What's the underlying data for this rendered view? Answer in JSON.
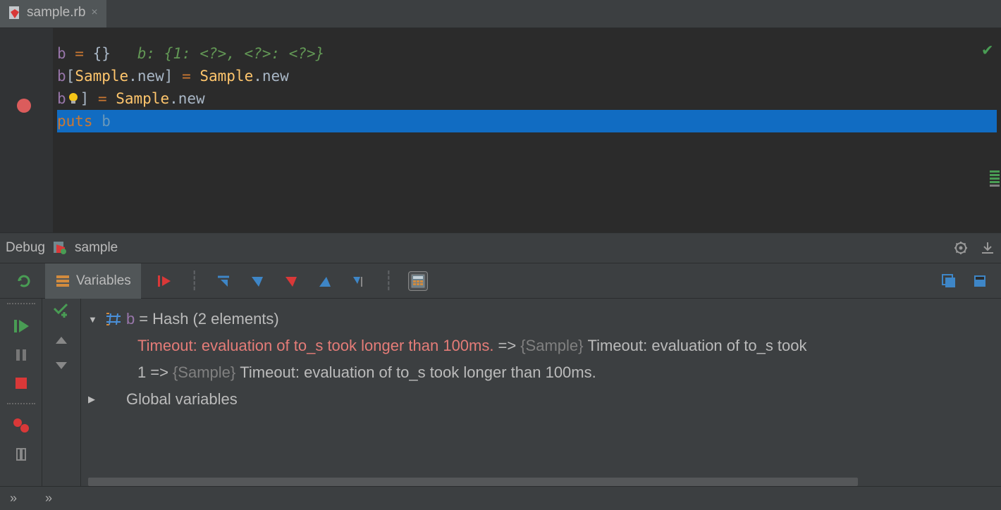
{
  "tab": {
    "filename": "sample.rb"
  },
  "editor": {
    "line1": {
      "var": "b",
      "eq": " = ",
      "braces": "{}",
      "comment": "   b: {1: <?>, <?>: <?>}"
    },
    "line2": {
      "var": "b",
      "lbracket": "[",
      "class1": "Sample",
      "dot1": ".",
      "method1": "new",
      "rbracket": "]",
      "eq": " = ",
      "class2": "Sample",
      "dot2": ".",
      "method2": "new"
    },
    "line3": {
      "var": "b",
      "rbracket": "]",
      "eq": " = ",
      "class1": "Sample",
      "dot1": ".",
      "method1": "new"
    },
    "line4": {
      "kw": "puts ",
      "arg": "b"
    }
  },
  "debug_header": {
    "label": "Debug",
    "config": "sample"
  },
  "variables_tab": "Variables",
  "vars": {
    "b_name": "b",
    "b_eq": " = ",
    "b_type": "Hash ",
    "b_count": "(2 elements)",
    "row1_timeout": "Timeout: evaluation of to_s took longer than 100ms.",
    "row1_arrow": " => ",
    "row1_sample": "{Sample} ",
    "row1_tail": "Timeout: evaluation of to_s took ",
    "row2_key": "1",
    "row2_arrow": " => ",
    "row2_sample": "{Sample} ",
    "row2_tail": "Timeout: evaluation of to_s took longer than 100ms.",
    "globals": "Global variables"
  }
}
